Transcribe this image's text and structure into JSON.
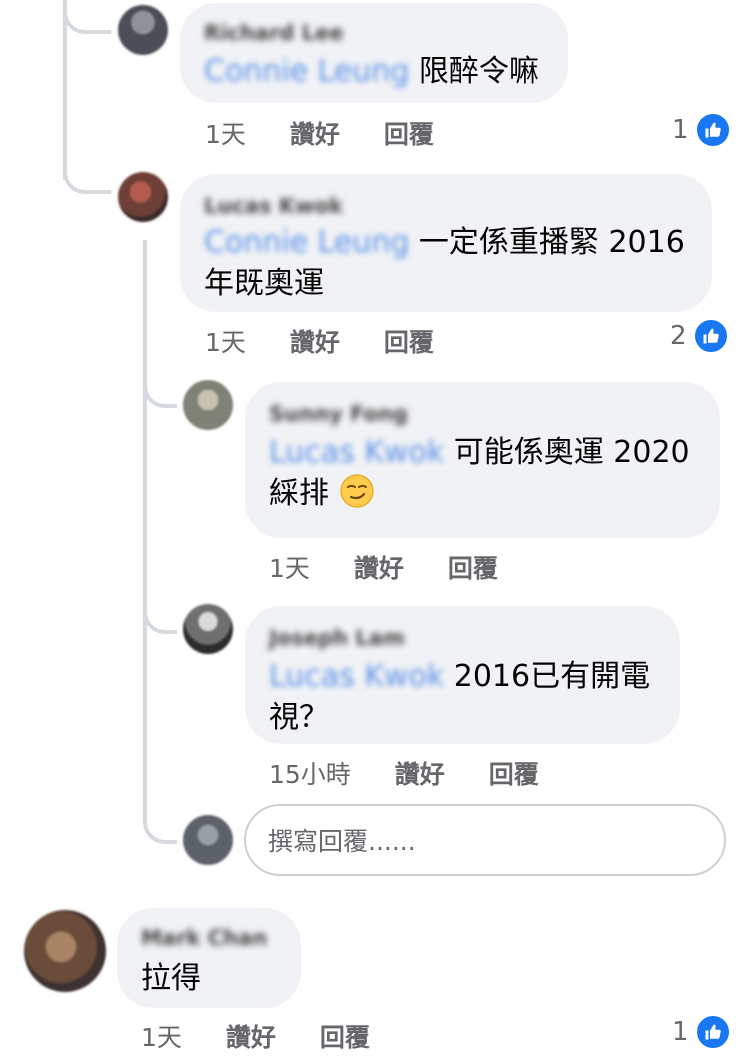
{
  "comments": [
    {
      "author": "Richard Lee",
      "mention": "Connie Leung",
      "text_line1": "限醉令嘛",
      "text_line2": "",
      "time": "1天",
      "like": "讚好",
      "reply": "回覆",
      "reactions": "1"
    },
    {
      "author": "Lucas Kwok",
      "mention": "Connie Leung",
      "text_line1": "一定係重播緊 2016",
      "text_line2": "年既奧運",
      "time": "1天",
      "like": "讚好",
      "reply": "回覆",
      "reactions": "2"
    },
    {
      "author": "Sunny Fong",
      "mention": "Lucas Kwok",
      "text_line1": "可能係奧運 2020",
      "text_line2": "綵排",
      "time": "1天",
      "like": "讚好",
      "reply": "回覆",
      "reactions": ""
    },
    {
      "author": "Joseph Lam",
      "mention": "Lucas Kwok",
      "text_line1": "2016已有開電",
      "text_line2": "視？",
      "time": "15小時",
      "like": "讚好",
      "reply": "回覆",
      "reactions": ""
    },
    {
      "author": "Mark Chan",
      "mention": "",
      "text_line1": "拉得",
      "text_line2": "",
      "time": "1天",
      "like": "讚好",
      "reply": "回覆",
      "reactions": "1"
    }
  ],
  "composer": {
    "placeholder": "撰寫回覆......"
  },
  "icons": {
    "like": "thumbs-up-icon",
    "smirk": "smirking-face-emoji"
  },
  "colors": {
    "bubble": "#f0f2f5",
    "like_blue": "#1a77f2",
    "mention": "#3578e5",
    "meta": "#65676b"
  }
}
